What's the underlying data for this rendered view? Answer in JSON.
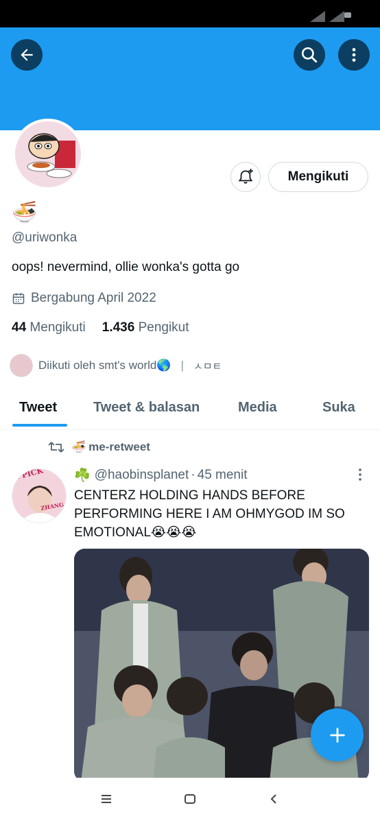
{
  "profile": {
    "name_emoji": "🍜",
    "handle": "@uriwonka",
    "bio": "oops! nevermind, ollie wonka's gotta go",
    "joined": "Bergabung April 2022",
    "following_count": "44",
    "following_label": "Mengikuti",
    "followers_count": "1.436",
    "followers_label": "Pengikut",
    "followed_by": "Diikuti oleh smt's world🌎",
    "followed_by_extra": "ㅅㅁㅌ",
    "follow_button": "Mengikuti"
  },
  "tabs": [
    {
      "label": "Tweet",
      "active": true
    },
    {
      "label": "Tweet & balasan",
      "active": false
    },
    {
      "label": "Media",
      "active": false
    },
    {
      "label": "Suka",
      "active": false
    }
  ],
  "tweet": {
    "retweet_emoji": "🍜",
    "retweet_label": "me-retweet",
    "author_emoji": "☘️",
    "author_handle": "@haobinsplanet",
    "separator": "·",
    "time": "45 menit",
    "text": "CENTERZ HOLDING HANDS BEFORE PERFORMING HERE I AM OHMYGOD IM SO EMOTIONAL😭😭😭",
    "avatar_text_top": "I PICK",
    "avatar_text_bottom": "ZHANG HAO"
  },
  "icons": {
    "back": "arrow-left-icon",
    "search": "search-icon",
    "more": "more-vertical-icon",
    "bell": "bell-plus-icon",
    "calendar": "calendar-icon",
    "retweet": "retweet-icon",
    "compose": "plus-icon"
  },
  "colors": {
    "accent": "#1d9bf0",
    "text": "#0f1419",
    "muted": "#536471"
  }
}
